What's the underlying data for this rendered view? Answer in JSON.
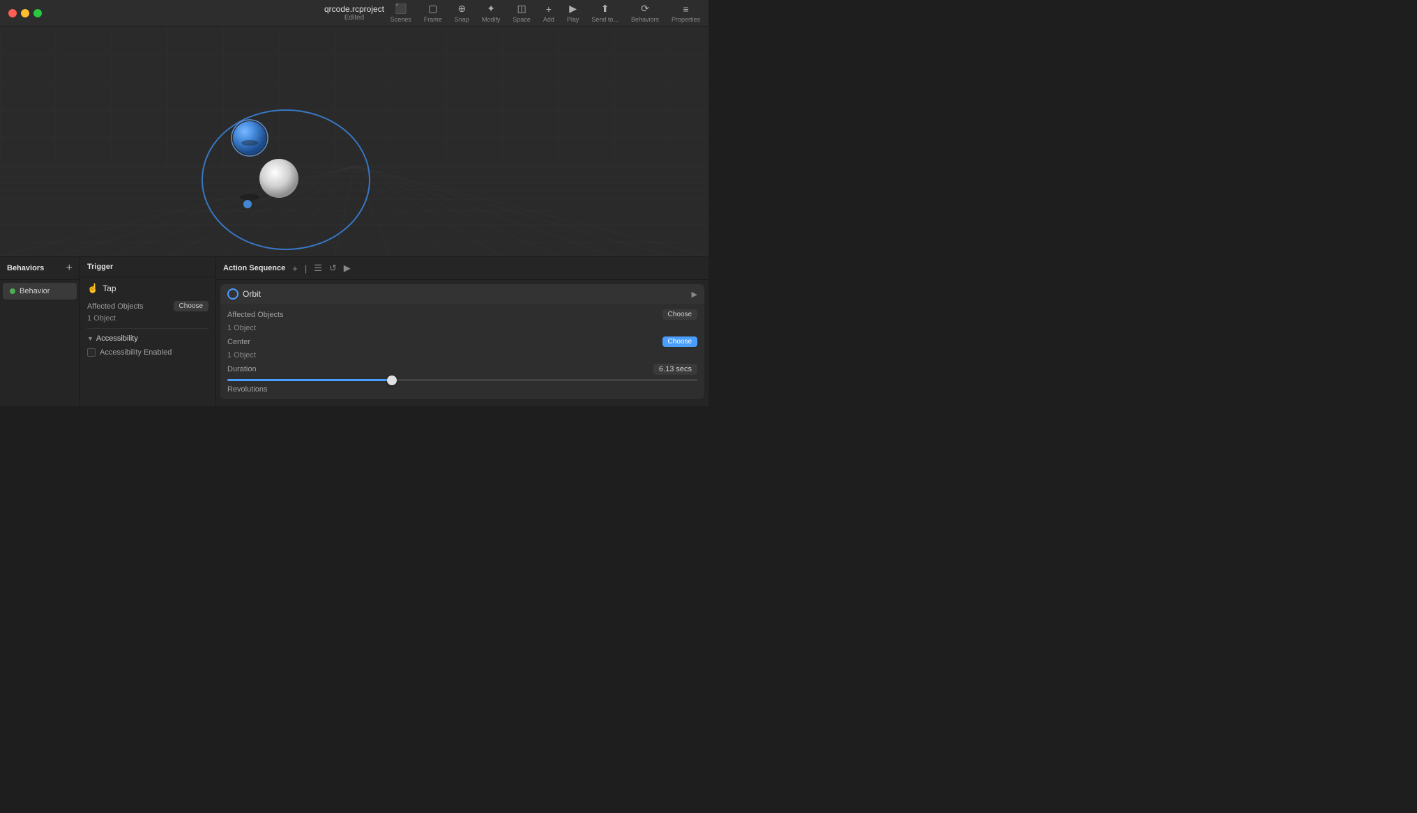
{
  "titlebar": {
    "title": "qrcode.rcproject",
    "subtitle": "Edited"
  },
  "toolbar": {
    "items": [
      {
        "id": "scenes",
        "icon": "⬛",
        "label": "Scenes"
      },
      {
        "id": "frame",
        "icon": "⬜",
        "label": "Frame"
      },
      {
        "id": "snap",
        "icon": "⊕",
        "label": "Snap"
      },
      {
        "id": "modify",
        "icon": "✥",
        "label": "Modify"
      },
      {
        "id": "space",
        "icon": "◫",
        "label": "Space"
      },
      {
        "id": "add",
        "icon": "+",
        "label": "Add"
      },
      {
        "id": "play",
        "icon": "▶",
        "label": "Play"
      },
      {
        "id": "send_to",
        "icon": "⬆",
        "label": "Send to..."
      },
      {
        "id": "behaviors",
        "icon": "⟳",
        "label": "Behaviors"
      },
      {
        "id": "properties",
        "icon": "≡",
        "label": "Properties"
      }
    ]
  },
  "panels": {
    "behaviors": {
      "title": "Behaviors",
      "add_label": "+",
      "items": [
        {
          "name": "Behavior",
          "active": true
        }
      ]
    },
    "trigger": {
      "title": "Trigger",
      "trigger_name": "Tap",
      "affected_objects_label": "Affected Objects",
      "affected_objects_value": "1 Object",
      "choose_label": "Choose",
      "accessibility_label": "Accessibility",
      "accessibility_enabled_label": "Accessibility Enabled"
    },
    "action_sequence": {
      "title": "Action Sequence",
      "add_label": "+",
      "orbit": {
        "title": "Orbit",
        "affected_objects_label": "Affected Objects",
        "affected_objects_value": "1 Object",
        "affected_objects_choose": "Choose",
        "center_label": "Center",
        "center_value": "1 Object",
        "center_choose": "Choose",
        "duration_label": "Duration",
        "duration_value": "6.13 secs",
        "revolutions_label": "Revolutions"
      }
    }
  }
}
